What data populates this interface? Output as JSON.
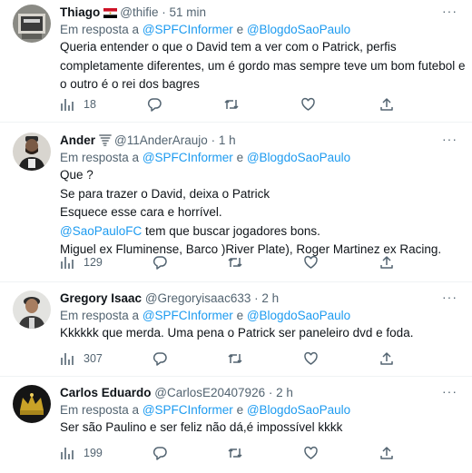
{
  "reply_prefix": "Em resposta a",
  "reply_mention_1": "@SPFCInformer",
  "reply_and": "e",
  "reply_mention_2": "@BlogdoSaoPaulo",
  "separator": "·",
  "more_label": "···",
  "colors": {
    "link": "#1d9bf0",
    "muted": "#536471",
    "text": "#0f1419",
    "divider": "#eff3f4"
  },
  "tweets": [
    {
      "name": "Thiago",
      "handle": "@thifie",
      "time": "51 min",
      "badge_icon": "egypt-flag-icon",
      "lines": [
        "Queria entender o que o David tem a ver com o Patrick, perfis",
        "completamente diferentes, um é gordo mas sempre teve um bom futebol e",
        "o outro é o rei dos bagres"
      ],
      "views": "18"
    },
    {
      "name": "Ander",
      "handle": "@11AnderAraujo",
      "time": "1 h",
      "badge_icon": "tornado-icon",
      "lines": [
        "Que ?",
        "Se para trazer o David, deixa o Patrick",
        "Esquece esse cara e horrível."
      ],
      "mention_line_link": "@SaoPauloFC",
      "mention_line_rest": " tem que buscar jogadores bons.",
      "last_line": "Miguel ex Fluminense, Barco )River Plate), Roger Martinez ex Racing.",
      "views": "129"
    },
    {
      "name": "Gregory Isaac",
      "handle": "@Gregoryisaac633",
      "time": "2 h",
      "lines": [
        "Kkkkkk que merda. Uma pena o Patrick ser paneleiro dvd e foda."
      ],
      "views": "307"
    },
    {
      "name": "Carlos Eduardo",
      "handle": "@CarlosE20407926",
      "time": "2 h",
      "lines": [
        "Ser são Paulino e ser feliz não dá,é impossível kkkk"
      ],
      "views": "199"
    }
  ]
}
